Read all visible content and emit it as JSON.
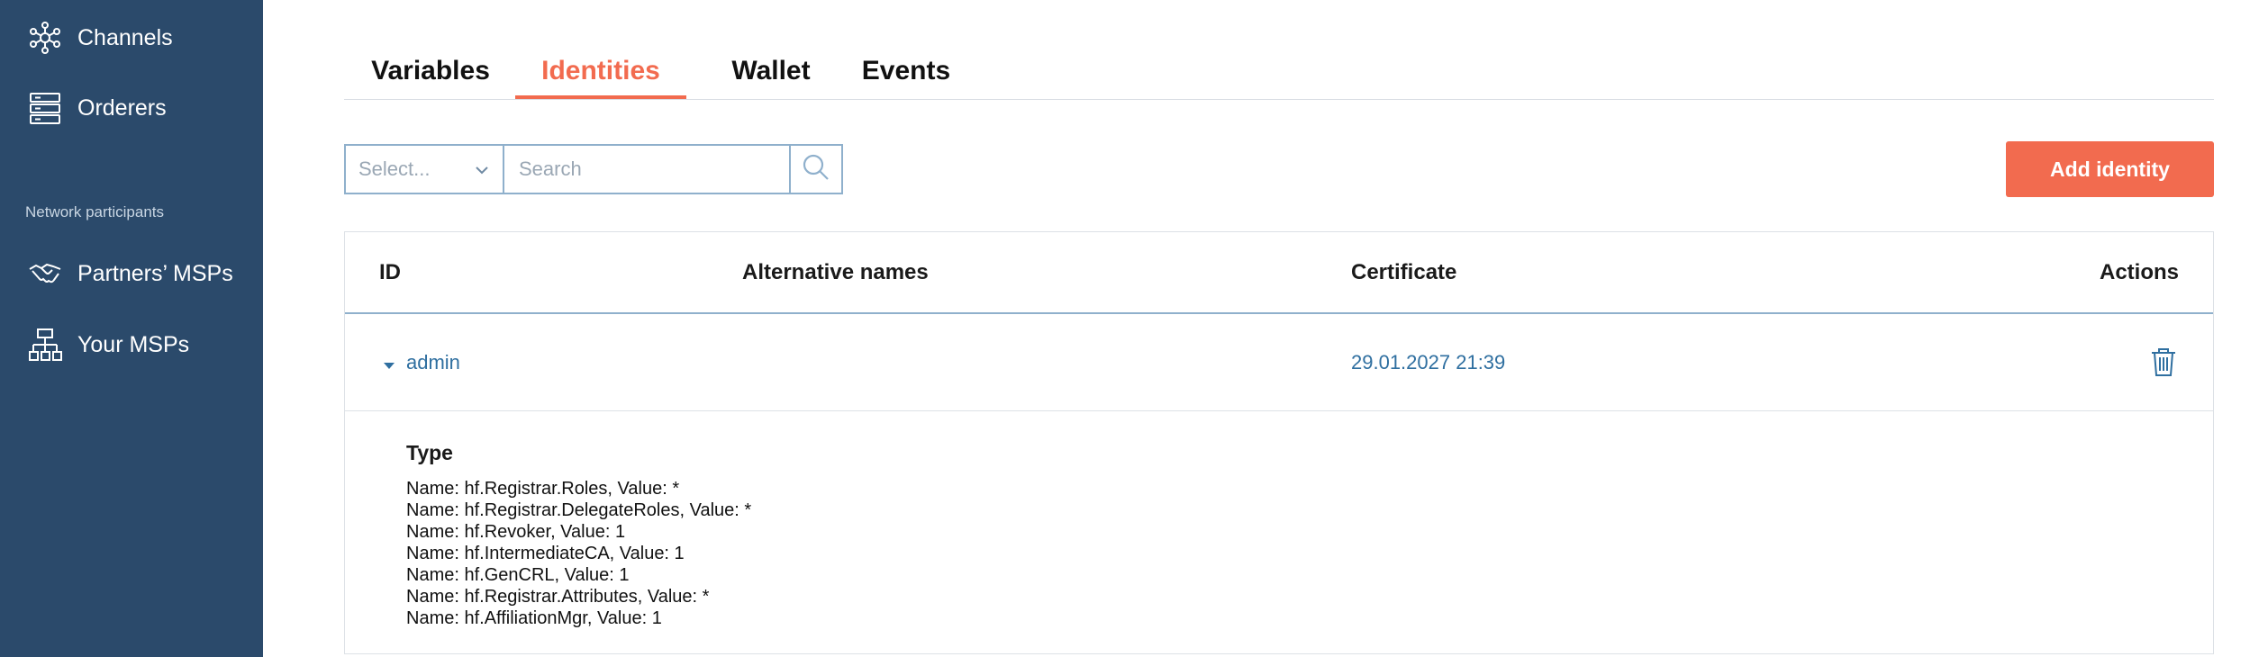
{
  "sidebar": {
    "items": [
      {
        "label": "Channels",
        "icon": "channels-icon"
      },
      {
        "label": "Orderers",
        "icon": "server-icon"
      }
    ],
    "section_title": "Network participants",
    "participants": [
      {
        "label": "Partners’ MSPs",
        "icon": "handshake-icon"
      },
      {
        "label": "Your MSPs",
        "icon": "org-chart-icon"
      }
    ]
  },
  "tabs": [
    {
      "label": "Variables",
      "active": false
    },
    {
      "label": "Identities",
      "active": true
    },
    {
      "label": "Wallet",
      "active": false
    },
    {
      "label": "Events",
      "active": false
    }
  ],
  "filter": {
    "select_placeholder": "Select...",
    "search_placeholder": "Search"
  },
  "add_button": "Add identity",
  "table": {
    "columns": [
      "ID",
      "Alternative names",
      "Certificate",
      "Actions"
    ],
    "rows": [
      {
        "id": "admin",
        "alternative_names": "",
        "certificate": "29.01.2027 21:39"
      }
    ]
  },
  "details": {
    "title": "Type",
    "attributes": [
      "Name: hf.Registrar.Roles, Value: *",
      "Name: hf.Registrar.DelegateRoles, Value: *",
      "Name: hf.Revoker, Value: 1",
      "Name: hf.IntermediateCA, Value: 1",
      "Name: hf.GenCRL, Value: 1",
      "Name: hf.Registrar.Attributes, Value: *",
      "Name: hf.AffiliationMgr, Value: 1"
    ]
  },
  "colors": {
    "sidebar": "#2b4a6b",
    "accent": "#f26b4f",
    "link": "#2f6fa0",
    "border": "#8fb0cc"
  }
}
